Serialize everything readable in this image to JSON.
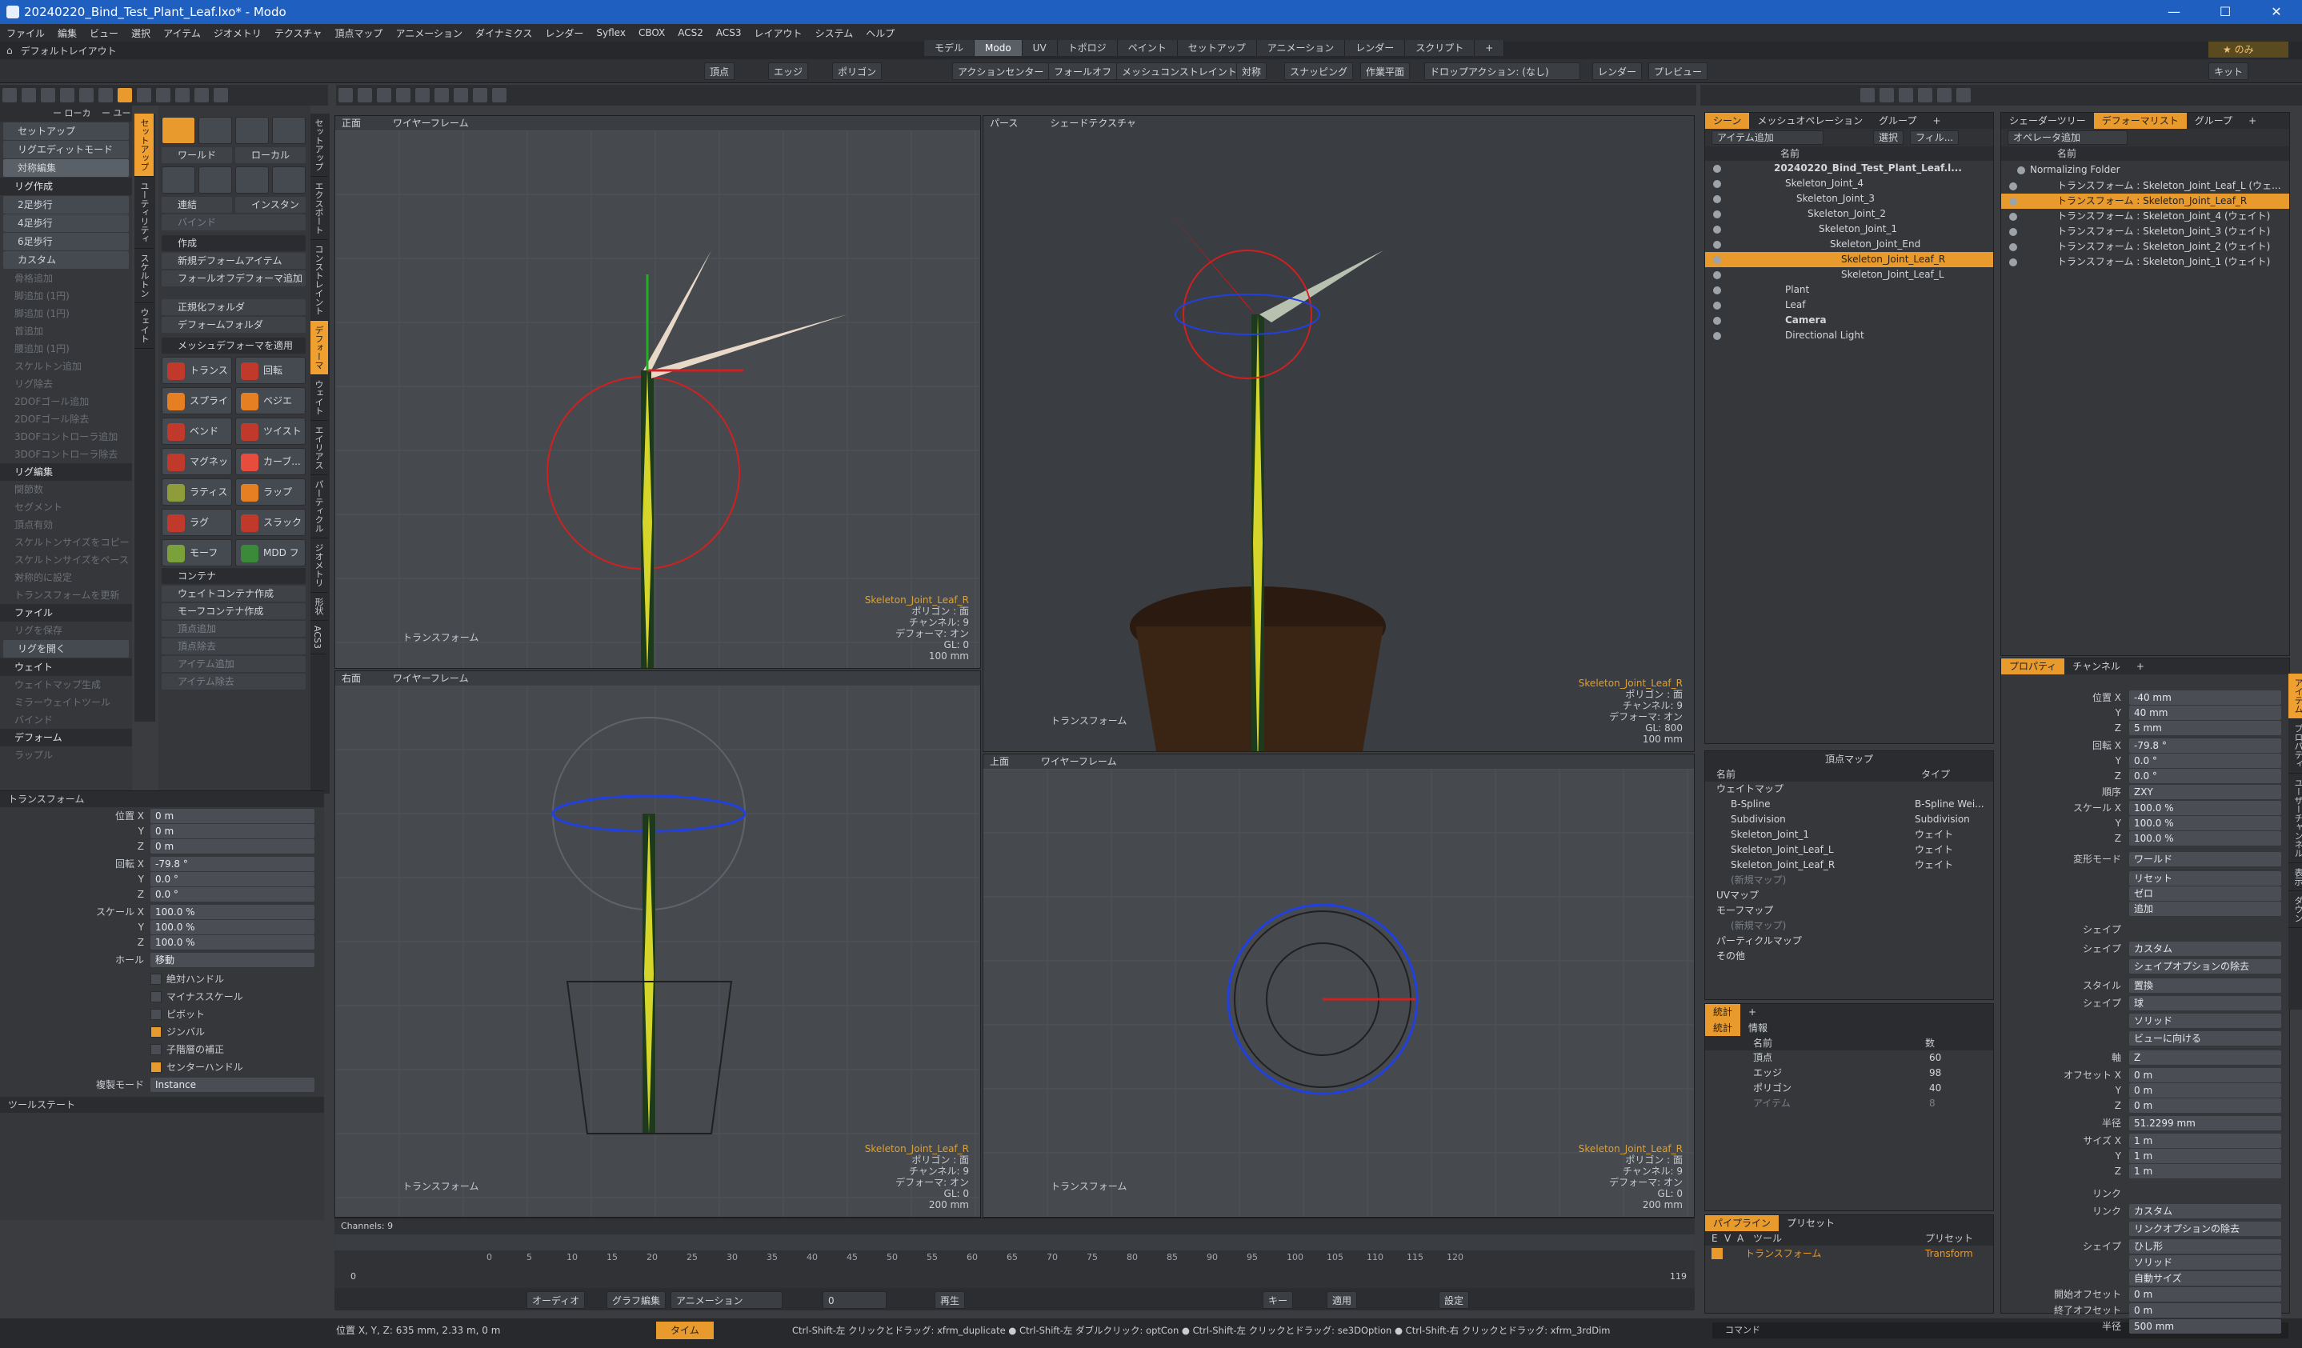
{
  "window": {
    "title": "20240220_Bind_Test_Plant_Leaf.lxo* - Modo"
  },
  "menu": [
    "ファイル",
    "編集",
    "ビュー",
    "選択",
    "アイテム",
    "ジオメトリ",
    "テクスチャ",
    "頂点マップ",
    "アニメーション",
    "ダイナミクス",
    "レンダー",
    "Syflex",
    "CBOX",
    "ACS2",
    "ACS3",
    "レイアウト",
    "システム",
    "ヘルプ"
  ],
  "layout_label": "デフォルトレイアウト",
  "tabs": [
    "モデル",
    "Modo",
    "UV",
    "トポロジ",
    "ペイント",
    "セットアップ",
    "アニメーション",
    "レンダー",
    "スクリプト",
    "+"
  ],
  "toolbar": {
    "vertex": "頂点",
    "edge": "エッジ",
    "polygon": "ポリゴン",
    "action_center": "アクションセンター",
    "falloff": "フォールオフ",
    "mesh_constraint": "メッシュコンストレイント",
    "symmetry": "対称",
    "snapping": "スナッピング",
    "workplane": "作業平面",
    "drop_action": "ドロップアクション: (なし)",
    "render": "レンダー",
    "preview": "プレビュー",
    "kit": "キット",
    "of": "のみ",
    "user": "ユーザー"
  },
  "left_panel": {
    "mode_a": "ー ローカ",
    "mode_b": "ー ユーザ",
    "items": [
      {
        "label": "セットアップ",
        "style": "btn"
      },
      {
        "label": "リグエディットモード",
        "style": "btn"
      },
      {
        "label": "対称編集",
        "style": "btn act"
      },
      {
        "label": "リグ作成",
        "style": "hdr"
      },
      {
        "label": "2足歩行",
        "style": "btn"
      },
      {
        "label": "4足歩行",
        "style": "btn"
      },
      {
        "label": "6足歩行",
        "style": "btn"
      },
      {
        "label": "カスタム",
        "style": "btn"
      },
      {
        "label": "骨格追加",
        "style": "dim"
      },
      {
        "label": "脚追加 (1円)",
        "style": "dim"
      },
      {
        "label": "脚追加 (1円)",
        "style": "dim"
      },
      {
        "label": "首追加",
        "style": "dim"
      },
      {
        "label": "腰追加 (1円)",
        "style": "dim"
      },
      {
        "label": "スケルトン追加",
        "style": "dim"
      },
      {
        "label": "リグ除去",
        "style": "dim"
      },
      {
        "label": "2DOFゴール追加",
        "style": "dim"
      },
      {
        "label": "2DOFゴール除去",
        "style": "dim"
      },
      {
        "label": "3DOFコントローラ追加",
        "style": "dim"
      },
      {
        "label": "3DOFコントローラ除去",
        "style": "dim"
      },
      {
        "label": "リグ編集",
        "style": "hdr"
      },
      {
        "label": "関節数",
        "style": "dim"
      },
      {
        "label": "セグメント",
        "style": "dim"
      },
      {
        "label": "頂点有効",
        "style": "dim"
      },
      {
        "label": "スケルトンサイズをコピー",
        "style": "dim"
      },
      {
        "label": "スケルトンサイズをペースト",
        "style": "dim"
      },
      {
        "label": "対称的に設定",
        "style": "dim"
      },
      {
        "label": "トランスフォームを更新",
        "style": "dim"
      },
      {
        "label": "ファイル",
        "style": "hdr"
      },
      {
        "label": "リグを保存",
        "style": "dim"
      },
      {
        "label": "リグを開く",
        "style": "btn"
      },
      {
        "label": "ウェイト",
        "style": "hdr"
      },
      {
        "label": "ウェイトマップ生成",
        "style": "dim"
      },
      {
        "label": "ミラーウェイトツール",
        "style": "dim"
      },
      {
        "label": "バインド",
        "style": "dim"
      },
      {
        "label": "デフォーム",
        "style": "hdr"
      },
      {
        "label": "ラップル",
        "style": "dim"
      }
    ]
  },
  "left_vtabs": [
    "セットアップ",
    "ユーティリティ",
    "スケルトン",
    "ウェイト"
  ],
  "mid_vtabs": [
    "セットアップ",
    "エクスポート",
    "コンストレイント",
    "デフォーマ",
    "ウェイト",
    "エイリアス",
    "パーティクル",
    "ジオメトリ",
    "形状",
    "ACS3"
  ],
  "mid_panel": {
    "world": "ワールド",
    "local": "ローカル",
    "bind": "連結",
    "instance": "インスタンス",
    "bind2": "バインド",
    "create": "作成",
    "new_deformer": "新規デフォームアイテム",
    "add_falloff": "フォールオフデフォーマ追加",
    "normalize_folder": "正規化フォルダ",
    "deform_folder": "デフォームフォルダ",
    "mesh_deformer": "メッシュデフォーマを適用",
    "buttons": [
      "トランスフ...",
      "回転",
      "スプライン",
      "ベジエ",
      "ベンド",
      "ツイスト",
      "マグネット",
      "カーブ...",
      "ラティス",
      "ラップ",
      "ラグ",
      "スラック",
      "モーフ",
      "MDD ファ..."
    ],
    "container": "コンテナ",
    "c_items": [
      "ウェイトコンテナ作成",
      "モーフコンテナ作成",
      "頂点追加",
      "頂点除去",
      "アイテム追加",
      "アイテム除去"
    ]
  },
  "properties": {
    "section": "トランスフォーム",
    "position_label": "位置",
    "rotation_label": "回転",
    "scale_label": "スケール",
    "pos": [
      "0 m",
      "0 m",
      "0 m"
    ],
    "rot": [
      "-79.8 °",
      "0.0 °",
      "0.0 °"
    ],
    "scale": [
      "100.0 %",
      "100.0 %",
      "100.0 %"
    ],
    "hold_label": "ホール",
    "hold_value": "移動",
    "checks": [
      {
        "label": "絶対ハンドル",
        "on": false
      },
      {
        "label": "マイナススケール",
        "on": false
      },
      {
        "label": "ピボット",
        "on": false
      },
      {
        "label": "ジンバル",
        "on": true
      },
      {
        "label": "子階層の補正",
        "on": false
      },
      {
        "label": "センターハンドル",
        "on": true
      }
    ],
    "link_label": "複製モード",
    "link_value": "Instance",
    "tool_state": "ツールステート"
  },
  "viewports": {
    "front": {
      "name": "正面",
      "shade": "ワイヤーフレーム",
      "item": "Skeleton_Joint_Leaf_R",
      "poly": "ポリゴン : 面",
      "ch": "チャンネル: 9",
      "deform": "デフォーマ: オン",
      "gl": "GL: 0",
      "size": "100 mm",
      "label": "トランスフォーム"
    },
    "persp": {
      "name": "パース",
      "shade": "シェードテクスチャ",
      "item": "Skeleton_Joint_Leaf_R",
      "poly": "ポリゴン : 面",
      "ch": "チャンネル: 9",
      "deform": "デフォーマ: オン",
      "gl": "GL: 800",
      "size": "100 mm",
      "label": "トランスフォーム"
    },
    "right": {
      "name": "右面",
      "shade": "ワイヤーフレーム",
      "item": "Skeleton_Joint_Leaf_R",
      "poly": "ポリゴン : 面",
      "ch": "チャンネル: 9",
      "deform": "デフォーマ: オン",
      "gl": "GL: 0",
      "size": "200 mm",
      "label": "トランスフォーム"
    },
    "top": {
      "name": "上面",
      "shade": "ワイヤーフレーム",
      "item": "Skeleton_Joint_Leaf_R",
      "poly": "ポリゴン : 面",
      "ch": "チャンネル: 9",
      "deform": "デフォーマ: オン",
      "gl": "GL: 0",
      "size": "200 mm",
      "label": "トランスフォーム"
    }
  },
  "timeline": {
    "label": "Channels: 9",
    "ticks": [
      "0",
      "5",
      "10",
      "15",
      "20",
      "25",
      "30",
      "35",
      "40",
      "45",
      "50",
      "55",
      "60",
      "65",
      "70",
      "75",
      "80",
      "85",
      "90",
      "95",
      "100",
      "105",
      "110",
      "115",
      "120"
    ],
    "start": "0",
    "end": "119"
  },
  "playbar": {
    "audio": "オーディオ",
    "graph": "グラフ編集",
    "anim": "アニメーション",
    "frame": "0",
    "play": "再生",
    "keys": "キー",
    "apply": "適用",
    "settings": "設定"
  },
  "status": {
    "coords": "位置 X, Y, Z:  635 mm, 2.33 m, 0 m",
    "time": "タイム",
    "hint": "Ctrl-Shift-左 クリックとドラッグ: xfrm_duplicate ● Ctrl-Shift-左 ダブルクリック: optCon ● Ctrl-Shift-左 クリックとドラッグ: se3DOption ● Ctrl-Shift-右 クリックとドラッグ: xfrm_3rdDim",
    "command": "コマンド"
  },
  "scene": {
    "tabs": [
      "シーン",
      "メッシュオペレーション",
      "グループ",
      "+"
    ],
    "add_item": "アイテム追加",
    "filter": "フィル...",
    "select": "選択",
    "col": "名前",
    "rows": [
      {
        "label": "20240220_Bind_Test_Plant_Leaf.l...",
        "indent": 0,
        "sel": false,
        "bold": true
      },
      {
        "label": "Skeleton_Joint_4",
        "indent": 1,
        "sel": false
      },
      {
        "label": "Skeleton_Joint_3",
        "indent": 2,
        "sel": false
      },
      {
        "label": "Skeleton_Joint_2",
        "indent": 3,
        "sel": false
      },
      {
        "label": "Skeleton_Joint_1",
        "indent": 4,
        "sel": false
      },
      {
        "label": "Skeleton_Joint_End",
        "indent": 5,
        "sel": false
      },
      {
        "label": "Skeleton_Joint_Leaf_R",
        "indent": 6,
        "sel": true
      },
      {
        "label": "Skeleton_Joint_Leaf_L",
        "indent": 6,
        "sel": false
      },
      {
        "label": "Plant",
        "indent": 1,
        "sel": false
      },
      {
        "label": "Leaf",
        "indent": 1,
        "sel": false
      },
      {
        "label": "Camera",
        "indent": 1,
        "sel": false,
        "bold": true
      },
      {
        "label": "Directional Light",
        "indent": 1,
        "sel": false
      }
    ]
  },
  "shader": {
    "tabs": [
      "シェーダーツリー",
      "デフォーマリスト",
      "グループ",
      "+"
    ],
    "op": "オペレータ追加",
    "col": "名前",
    "folder": "Normalizing Folder",
    "rows": [
      "トランスフォーム : Skeleton_Joint_Leaf_L (ウェ...",
      "トランスフォーム : Skeleton_Joint_Leaf_R",
      "トランスフォーム : Skeleton_Joint_4 (ウェイト)",
      "トランスフォーム : Skeleton_Joint_3 (ウェイト)",
      "トランスフォーム : Skeleton_Joint_2 (ウェイト)",
      "トランスフォーム : Skeleton_Joint_1 (ウェイト)"
    ]
  },
  "vmap": {
    "title": "頂点マップ",
    "col_name": "名前",
    "col_type": "タイプ",
    "rows": [
      {
        "name": "ウェイトマップ",
        "type": "",
        "indent": 0
      },
      {
        "name": "B-Spline",
        "type": "B-Spline Wei...",
        "indent": 1
      },
      {
        "name": "Subdivision",
        "type": "Subdivision",
        "indent": 1
      },
      {
        "name": "Skeleton_Joint_1",
        "type": "ウェイト",
        "indent": 1
      },
      {
        "name": "Skeleton_Joint_Leaf_L",
        "type": "ウェイト",
        "indent": 1
      },
      {
        "name": "Skeleton_Joint_Leaf_R",
        "type": "ウェイト",
        "indent": 1
      },
      {
        "name": "(新規マップ)",
        "type": "",
        "indent": 1
      },
      {
        "name": "UVマップ",
        "type": "",
        "indent": 0
      },
      {
        "name": "モーフマップ",
        "type": "",
        "indent": 0
      },
      {
        "name": "(新規マップ)",
        "type": "",
        "indent": 1
      },
      {
        "name": "パーティクルマップ",
        "type": "",
        "indent": 0
      },
      {
        "name": "その他",
        "type": "",
        "indent": 0
      }
    ]
  },
  "stats": {
    "tabs": [
      "統計",
      "+"
    ],
    "subtabs": [
      "統計",
      "情報"
    ],
    "col_name": "名前",
    "col_num": "数",
    "rows": [
      {
        "name": "頂点",
        "n": "60"
      },
      {
        "name": "エッジ",
        "n": "98"
      },
      {
        "name": "ポリゴン",
        "n": "40"
      },
      {
        "name": "アイテム",
        "n": "8"
      }
    ]
  },
  "pipeline": {
    "tabs": [
      "パイプライン",
      "プリセット"
    ],
    "cols": [
      "E",
      "V",
      "A",
      "ツール",
      "プリセット"
    ],
    "row_tool": "トランスフォーム",
    "row_preset": "Transform"
  },
  "right_props": {
    "tabs": [
      "プロパティ",
      "チャンネル",
      "+"
    ],
    "position_label": "位置",
    "rotation_label": "回転",
    "order_label": "順序",
    "scale_label": "スケール",
    "pos": [
      "-40 mm",
      "40 mm",
      "5 mm"
    ],
    "rot": [
      "-79.8 °",
      "0.0 °",
      "0.0 °"
    ],
    "order": "ZXY",
    "scale": [
      "100.0 %",
      "100.0 %",
      "100.0 %"
    ],
    "xform_mode_label": "変形モード",
    "xform_mode": "ワールド",
    "reset": "リセット",
    "zero": "ゼロ",
    "add": "追加",
    "shape_hdr": "シェイプ",
    "shape_label": "シェイプ",
    "shape_value": "カスタム",
    "shape_opt": "シェイプオプションの除去",
    "style_label": "スタイル",
    "style_value": "置換",
    "shape2_label": "シェイプ",
    "shape2_value": "球",
    "solid": "ソリッド",
    "face_view": "ビューに向ける",
    "axis_label": "軸",
    "axis_value": "Z",
    "offset_label": "オフセット",
    "offset": [
      "0 m",
      "0 m",
      "0 m"
    ],
    "radius_label": "半径",
    "radius": "51.2299 mm",
    "size_label": "サイズ",
    "size": [
      "1 m",
      "1 m",
      "1 m"
    ],
    "link_hdr": "リンク",
    "link_label": "リンク",
    "link_value": "カスタム",
    "link_opt": "リンクオプションの除去",
    "link_shape_label": "シェイプ",
    "link_shape": "ひし形",
    "solid2": "ソリッド",
    "auto_size": "自動サイズ",
    "start_off_label": "開始オフセット",
    "start_off": "0 m",
    "end_off_label": "終了オフセット",
    "end_off": "0 m",
    "radius2_label": "半径",
    "radius2": "500 mm"
  },
  "right_vtabs": [
    "アイテム",
    "プロパティ",
    "ユーザーチャンネル",
    "表示",
    "ダウン"
  ]
}
